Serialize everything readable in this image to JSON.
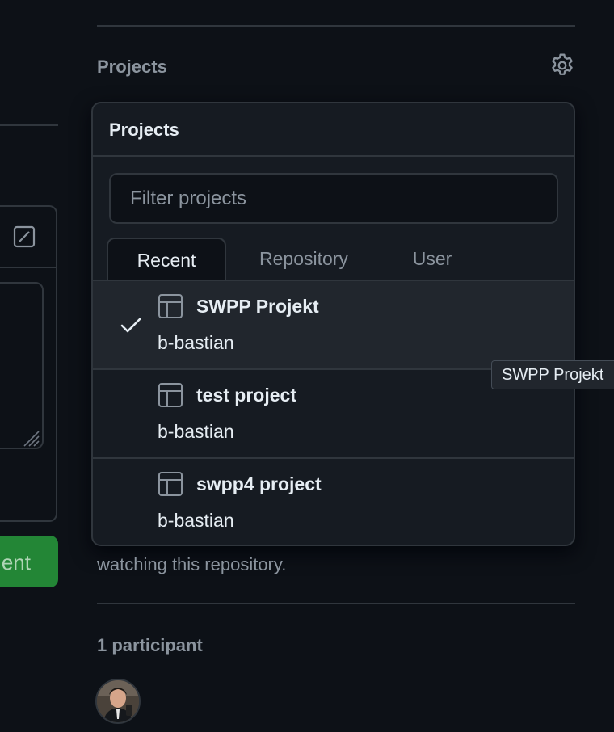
{
  "sidebar": {
    "projects_heading": "Projects",
    "settings_icon": "gear-icon",
    "watching_text": "watching this repository.",
    "participants_heading": "1 participant"
  },
  "comment_box": {
    "submit_label_partial": "ent",
    "submit_color": "#238636"
  },
  "popover": {
    "title": "Projects",
    "filter_placeholder": "Filter projects",
    "tabs": [
      {
        "label": "Recent",
        "active": true
      },
      {
        "label": "Repository",
        "active": false
      },
      {
        "label": "User",
        "active": false
      }
    ],
    "items": [
      {
        "name": "SWPP Projekt",
        "owner": "b-bastian",
        "selected": true,
        "icon": "table-icon"
      },
      {
        "name": "test project",
        "owner": "b-bastian",
        "selected": false,
        "icon": "table-icon"
      },
      {
        "name": "swpp4 project",
        "owner": "b-bastian",
        "selected": false,
        "icon": "table-icon"
      }
    ]
  },
  "tooltip": {
    "text": "SWPP Projekt"
  },
  "colors": {
    "background": "#0d1117",
    "panel": "#161b22",
    "border": "#30363d",
    "muted_text": "#8b949e",
    "text": "#e6edf3",
    "selected_row": "#21262d"
  }
}
